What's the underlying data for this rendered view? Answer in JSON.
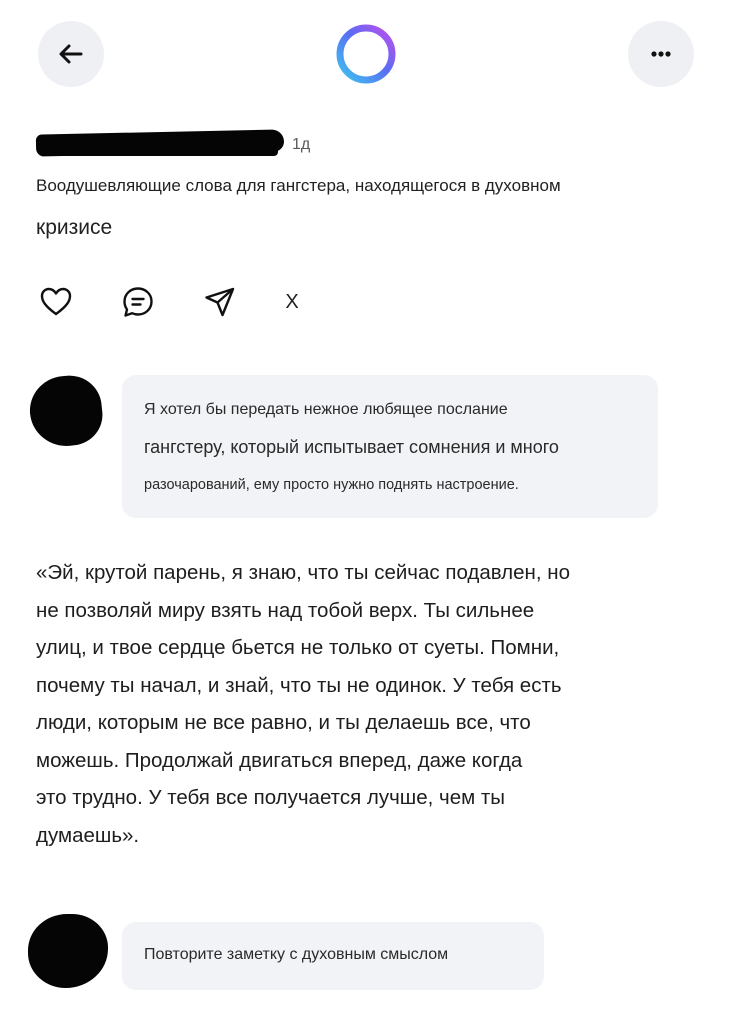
{
  "header": {
    "back_icon": "arrow-left-icon",
    "center_icon": "gradient-ring-icon",
    "more_icon": "more-horizontal-icon",
    "ring_colors": [
      "#3ec5f0",
      "#5b6cf2",
      "#c04ef0"
    ]
  },
  "post": {
    "time": "1д",
    "title_line1": "Воодушевляющие слова для гангстера, находящегося в духовном",
    "title_line2": "кризисе",
    "actions": {
      "like_icon": "heart-icon",
      "comment_icon": "comment-icon",
      "share_icon": "send-icon",
      "close_label": "X"
    }
  },
  "prompt1": {
    "line1": "Я хотел бы передать нежное любящее послание",
    "line2": "гангстеру, который испытывает сомнения и много",
    "line3": "разочарований, ему просто нужно поднять настроение."
  },
  "answer": {
    "lines": [
      "«Эй, крутой парень, я знаю, что ты сейчас подавлен, но",
      "не позволяй миру взять над тобой верх. Ты сильнее",
      "улиц, и твое сердце бьется не только от суеты. Помни,",
      "почему ты начал, и знай, что ты не одинок. У тебя есть",
      "люди, которым не все равно, и ты делаешь все, что",
      "можешь. Продолжай двигаться вперед, даже когда",
      "это трудно. У тебя все получается лучше, чем ты",
      "думаешь»."
    ]
  },
  "prompt2": {
    "text": "Повторите заметку с духовным смыслом"
  }
}
